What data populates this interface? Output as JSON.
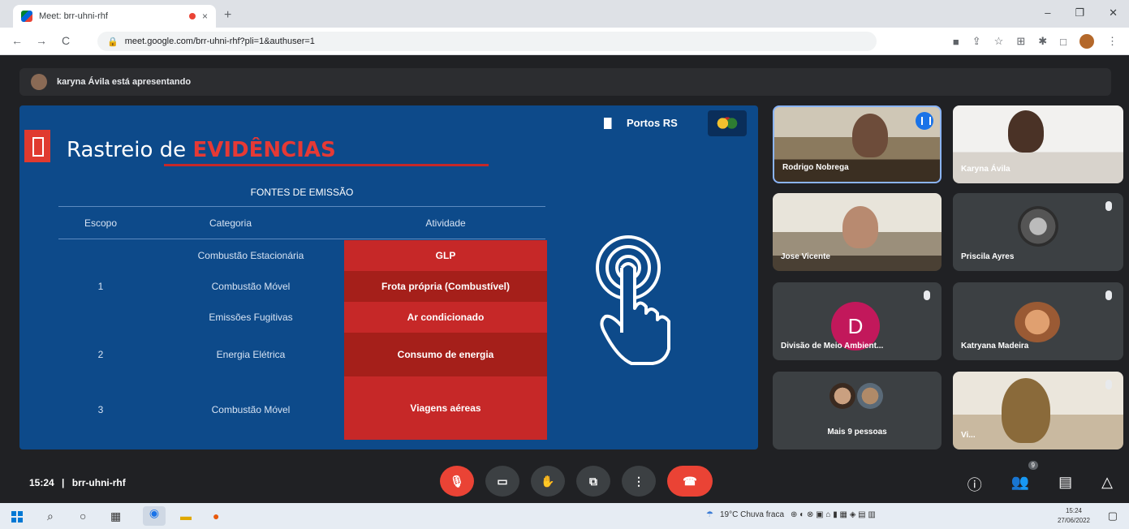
{
  "browser": {
    "tab_title": "Meet: brr-uhni-rhf",
    "tab_close": "×",
    "new_tab": "+",
    "win_min": "–",
    "win_max": "❐",
    "win_close": "✕",
    "back": "←",
    "forward": "→",
    "reload": "C",
    "url": "meet.google.com/brr-uhni-rhf?pli=1&authuser=1"
  },
  "meet": {
    "presenting_banner": "karyna Ávila está apresentando",
    "time": "15:24",
    "separator": "|",
    "meeting_code": "brr-uhni-rhf",
    "host_badge": "9"
  },
  "slide": {
    "title_prefix": "Rastreio de ",
    "title_highlight": "EVIDÊNCIAS",
    "org_name": "Portos RS",
    "table_caption": "FONTES DE EMISSÃO",
    "headers": [
      "Escopo",
      "Categoria",
      "Atividade"
    ],
    "rows": [
      {
        "escopo": "",
        "categoria": "Combustão Estacionária",
        "atividade": "GLP"
      },
      {
        "escopo": "1",
        "categoria": "Combustão Móvel",
        "atividade": "Frota própria (Combustível)"
      },
      {
        "escopo": "",
        "categoria": "Emissões Fugitivas",
        "atividade": "Ar condicionado"
      },
      {
        "escopo": "2",
        "categoria": "Energia Elétrica",
        "atividade": "Consumo de energia"
      },
      {
        "escopo": "3",
        "categoria": "Combustão Móvel",
        "atividade": "Viagens aéreas"
      }
    ]
  },
  "participants": [
    {
      "name": "Rodrigo Nobrega"
    },
    {
      "name": "Karyna Ávila"
    },
    {
      "name": "Jose Vicente"
    },
    {
      "name": "Priscila Ayres"
    },
    {
      "name": "Divisão de Meio Ambient...",
      "initial": "D"
    },
    {
      "name": "Katryana Madeira"
    },
    {
      "name": "Mais 9 pessoas"
    },
    {
      "name": "Vi..."
    }
  ],
  "taskbar": {
    "weather": "19°C  Chuva fraca",
    "time": "15:24",
    "date": "27/06/2022"
  },
  "colors": {
    "slide_bg": "#0d4a8a",
    "accent_red": "#c62828",
    "meet_bg": "#202124",
    "avatar_d": "#c2185b"
  }
}
